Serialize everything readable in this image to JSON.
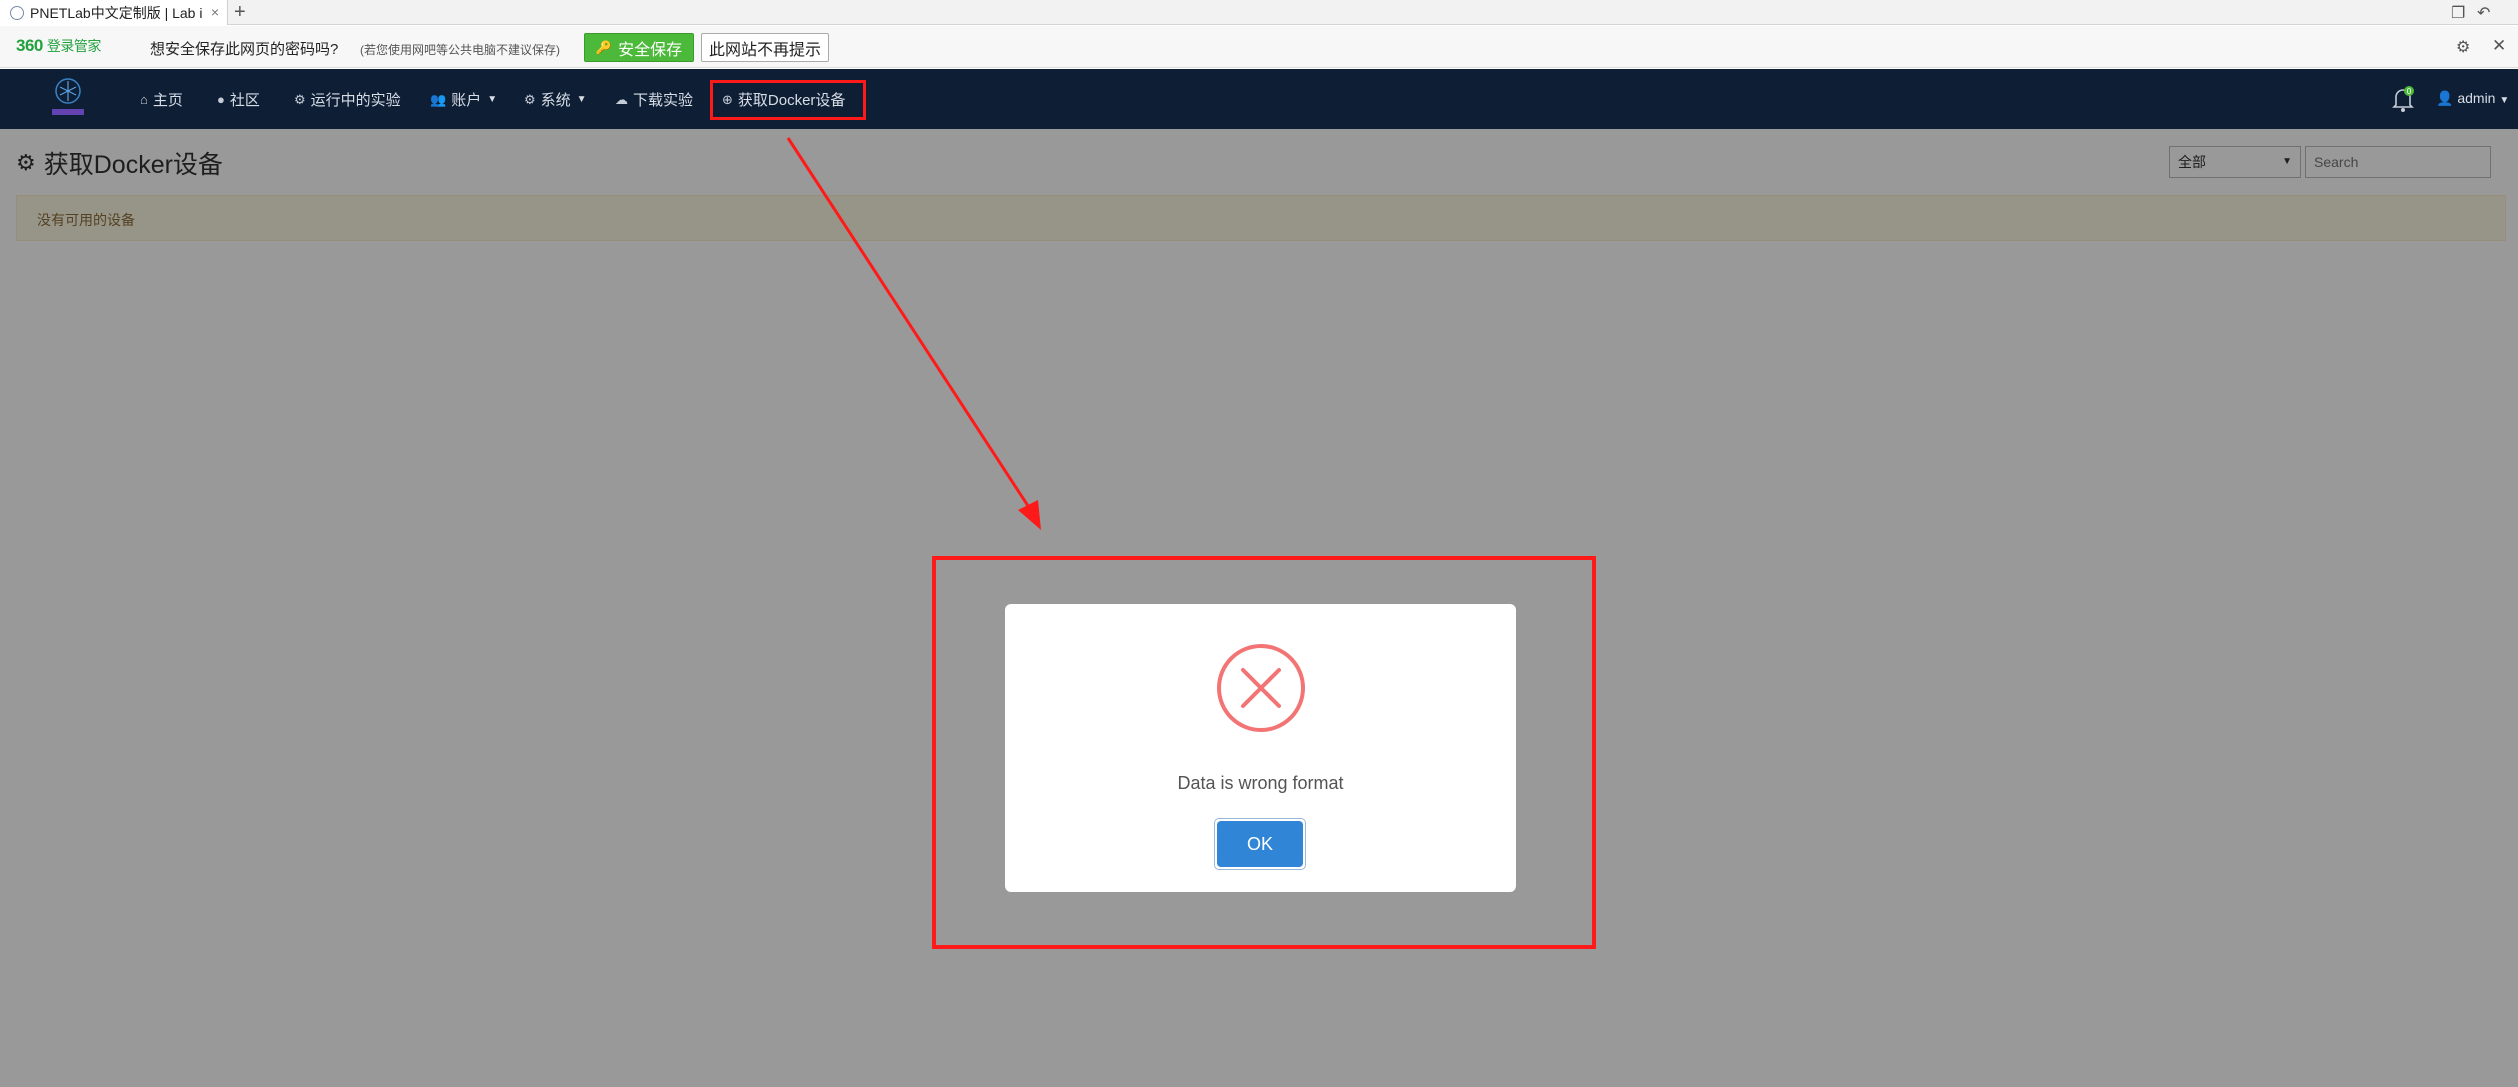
{
  "browser": {
    "tab_title": "PNETLab中文定制版 | Lab is S",
    "tab_close": "×",
    "new_tab": "+"
  },
  "password_bar": {
    "logo_brand": "360",
    "logo_text": "登录管家",
    "question": "想安全保存此网页的密码吗?",
    "note": "(若您使用网吧等公共电脑不建议保存)",
    "save_label": "安全保存",
    "nomore_label": "此网站不再提示"
  },
  "navbar": {
    "items": [
      {
        "label": "主页",
        "icon": "home-icon"
      },
      {
        "label": "社区",
        "icon": "globe-icon"
      },
      {
        "label": "运行中的实验",
        "icon": "cogs-icon"
      },
      {
        "label": "账户",
        "icon": "users-icon"
      },
      {
        "label": "系统",
        "icon": "gear-icon"
      },
      {
        "label": "下载实验",
        "icon": "cloud-download-icon"
      },
      {
        "label": "获取Docker设备",
        "icon": "plus-circle-icon"
      }
    ],
    "user": "admin",
    "notification_count": "0"
  },
  "page": {
    "title": "获取Docker设备",
    "filter_value": "全部",
    "search_placeholder": "Search",
    "alert": "没有可用的设备"
  },
  "modal": {
    "icon": "error-x-icon",
    "message": "Data is wrong format",
    "ok_label": "OK"
  },
  "colors": {
    "navbar": "#0e1f35",
    "annotation": "#ff1a1a",
    "ok_button": "#3085d6",
    "error": "#f27474"
  }
}
